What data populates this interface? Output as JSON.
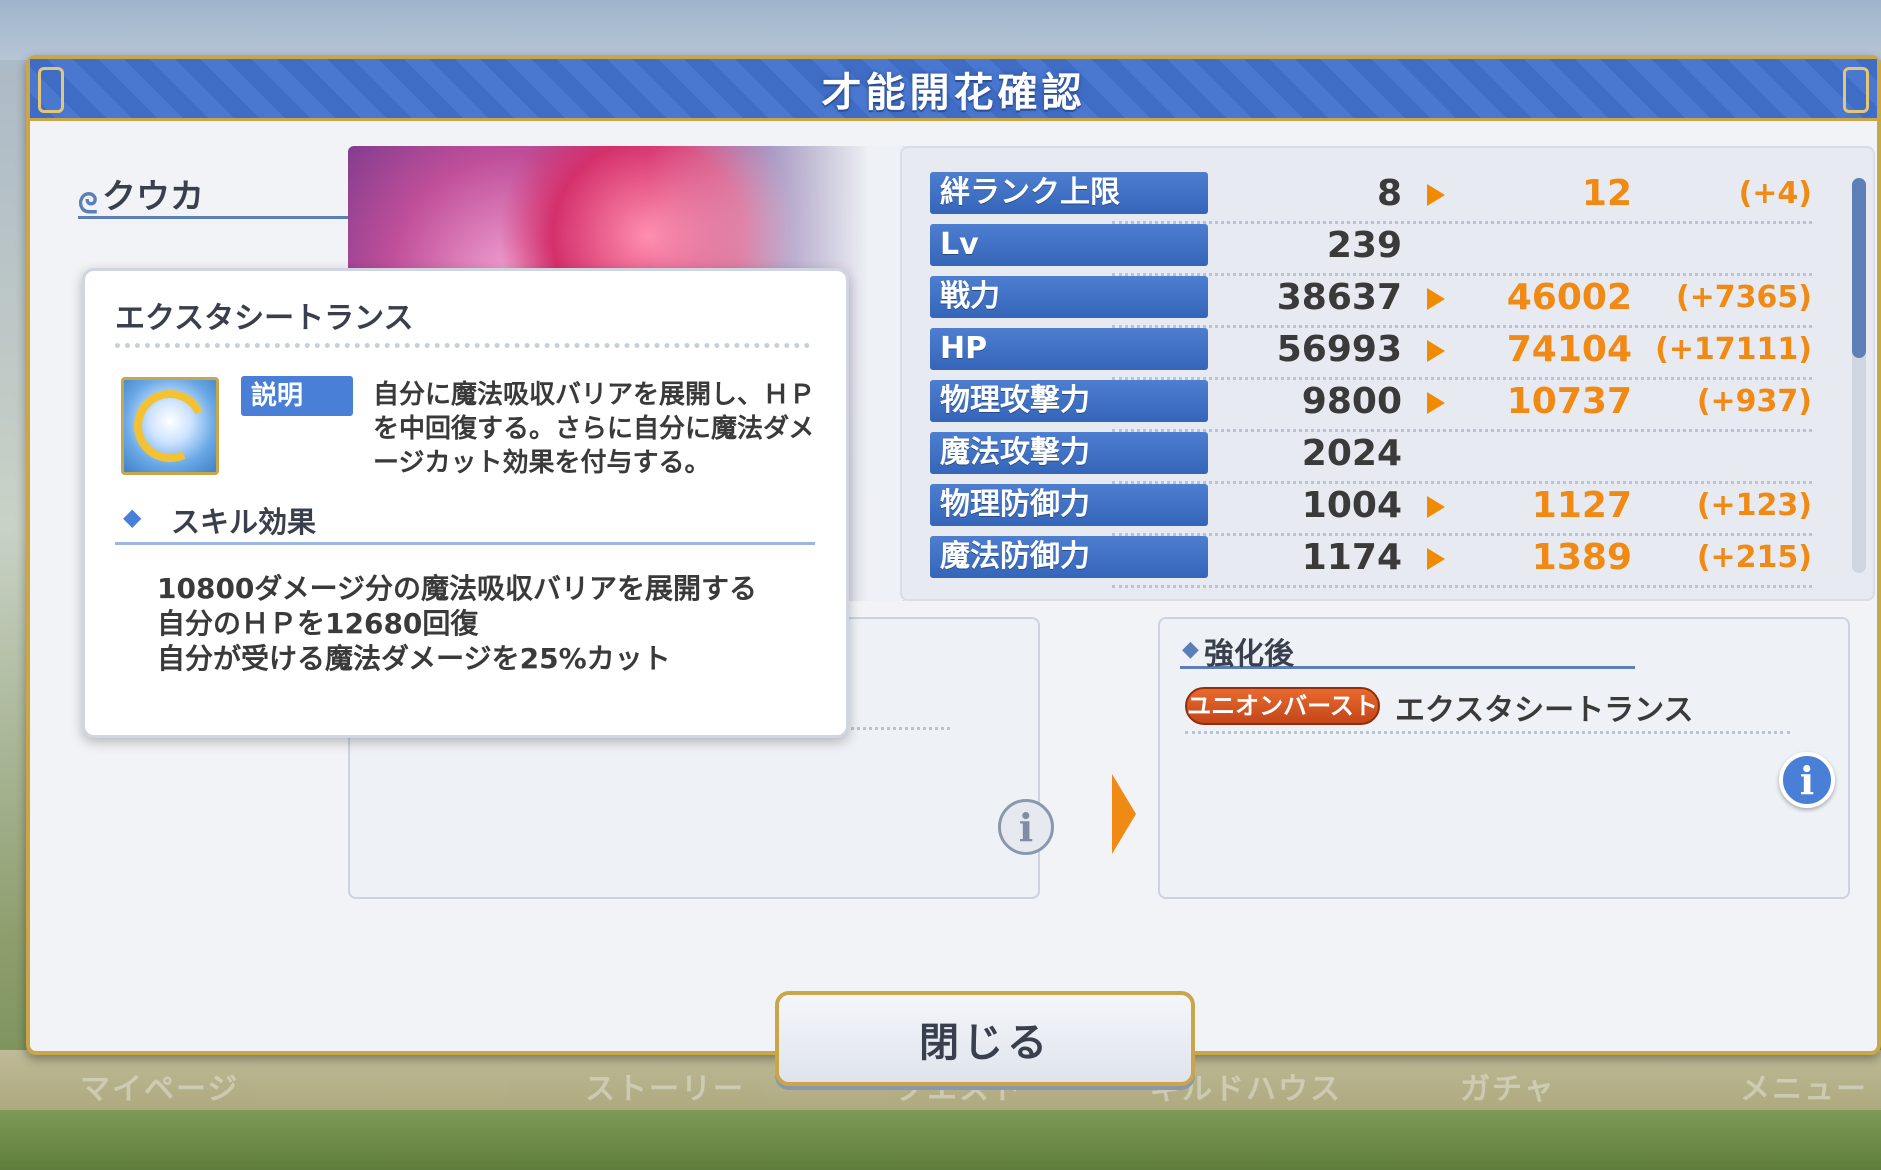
{
  "dialog": {
    "title": "才能開花確認",
    "character_name": "クウカ",
    "close_label": "閉じる"
  },
  "stats": [
    {
      "label": "絆ランク上限",
      "value": "8",
      "new": "12",
      "diff": "(+4)"
    },
    {
      "label": "Lv",
      "value": "239",
      "new": "",
      "diff": ""
    },
    {
      "label": "戦力",
      "value": "38637",
      "new": "46002",
      "diff": "(+7365)"
    },
    {
      "label": "HP",
      "value": "56993",
      "new": "74104",
      "diff": "(+17111)"
    },
    {
      "label": "物理攻撃力",
      "value": "9800",
      "new": "10737",
      "diff": "(+937)"
    },
    {
      "label": "魔法攻撃力",
      "value": "2024",
      "new": "",
      "diff": ""
    },
    {
      "label": "物理防御力",
      "value": "1004",
      "new": "1127",
      "diff": "(+123)"
    },
    {
      "label": "魔法防御力",
      "value": "1174",
      "new": "1389",
      "diff": "(+215)"
    }
  ],
  "skill_after": {
    "header": "強化後",
    "badge": "ユニオンバースト",
    "skill_name": "エクスタシートランス"
  },
  "tooltip": {
    "title": "エクスタシートランス",
    "desc_tag": "説明",
    "description": "自分に魔法吸収バリアを展開し、ＨＰを中回復する。さらに自分に魔法ダメージカット効果を付与する。",
    "effect_header": "スキル効果",
    "effects": [
      "10800ダメージ分の魔法吸収バリアを展開する",
      "自分のＨＰを12680回復",
      "自分が受ける魔法ダメージを25%カット"
    ]
  },
  "background_nav": [
    "マイページ",
    "ストーリー",
    "クエスト",
    "ギルドハウス",
    "ガチャ",
    "メニュー"
  ],
  "colors": {
    "accent_blue": "#4a7fd8",
    "increase_orange": "#f08a14",
    "frame_gold": "#c9a64a"
  }
}
